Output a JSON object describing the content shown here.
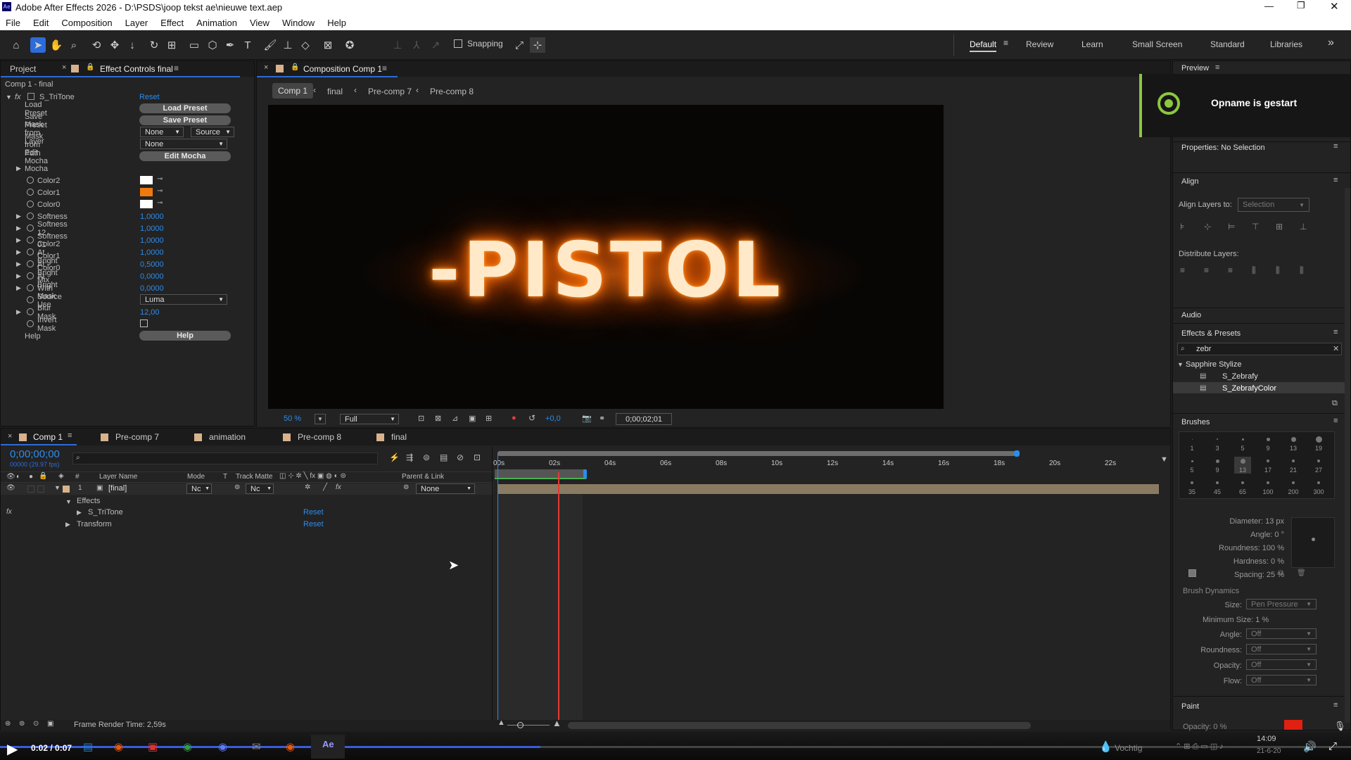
{
  "titlebar": {
    "title": "Adobe After Effects 2026 - D:\\PSDS\\joop tekst ae\\nieuwe text.aep",
    "app_icon": "Ae"
  },
  "menu": [
    "File",
    "Edit",
    "Composition",
    "Layer",
    "Effect",
    "Animation",
    "View",
    "Window",
    "Help"
  ],
  "toolbar": {
    "snapping": "Snapping",
    "workspaces": [
      "Default",
      "Review",
      "Learn",
      "Small Screen",
      "Standard",
      "Libraries"
    ],
    "overflow": "»"
  },
  "left_panel": {
    "tabs": {
      "project": "Project",
      "effect_controls": "Effect Controls final"
    },
    "header": "Comp 1 - final",
    "effect": {
      "name": "S_TriTone",
      "reset": "Reset"
    },
    "rows": {
      "load_preset": "Load Preset",
      "save_preset": "Save Preset",
      "mask_from_layer": "Mask from Layer",
      "mask_from_path": "Mask from Path",
      "edit_mocha": "Edit Mocha",
      "mocha": "Mocha",
      "color2": "Color2",
      "color1": "Color1",
      "color0": "Color0",
      "softness": "Softness",
      "softness_val": "1,0000",
      "softness12": "Softness 12",
      "softness12_val": "1,0000",
      "softness01": "Softness 01",
      "softness01_val": "1,0000",
      "color2_bright": "Color2 At Bright",
      "color2_bright_val": "1,0000",
      "color1_bright": "Color1 At Bright",
      "color1_bright_val": "0,5000",
      "color0_bright": "Color0 At Bright",
      "color0_bright_val": "0,0000",
      "mix": "Mix With Source",
      "mix_val": "0,0000",
      "mask_use": "Mask Use",
      "blur_mask": "Blur Mask",
      "blur_mask_val": "12,00",
      "invert_mask": "Invert Mask",
      "help": "Help"
    },
    "buttons": {
      "load_preset": "Load Preset",
      "save_preset": "Save Preset",
      "edit_mocha": "Edit Mocha",
      "help": "Help"
    },
    "dropdowns": {
      "mask_layer": "None",
      "mask_source": "Source",
      "mask_path": "None",
      "mask_use": "Luma"
    },
    "colors": {
      "color2": "#ffffff",
      "color1": "#f07a10",
      "color0": "#ffffff"
    }
  },
  "composition": {
    "tab": "Composition Comp 1",
    "breadcrumb": [
      "Comp 1",
      "final",
      "Pre-comp 7",
      "Pre-comp 8"
    ],
    "text": "-PISTOL",
    "zoom": "50 %",
    "resolution": "Full",
    "exposure": "+0,0",
    "timecode": "0;00;02;01"
  },
  "timeline": {
    "tabs": [
      "Comp 1",
      "Pre-comp 7",
      "animation",
      "Pre-comp 8",
      "final"
    ],
    "timecode": "0;00;00;00",
    "fps": "00000 (29.97 fps)",
    "columns": {
      "layer_name": "Layer Name",
      "mode": "Mode",
      "t": "T",
      "track_matte": "Track Matte",
      "parent": "Parent & Link",
      "hash": "#"
    },
    "layer": {
      "num": "1",
      "name": "[final]",
      "mode": "Nc",
      "matte": "Nc",
      "parent": "None"
    },
    "effects": "Effects",
    "effect_name": "S_TriTone",
    "transform": "Transform",
    "reset": "Reset",
    "ruler": [
      "00s",
      "02s",
      "04s",
      "06s",
      "08s",
      "10s",
      "12s",
      "14s",
      "16s",
      "18s",
      "20s",
      "22s"
    ],
    "frame_render": "Frame Render Time:  2,59s"
  },
  "right_panel": {
    "preview": "Preview",
    "toast": "Opname is gestart",
    "properties": "Properties: No Selection",
    "align": "Align",
    "align_layers_to": "Align Layers to:",
    "align_target": "Selection",
    "distribute": "Distribute Layers:",
    "audio": "Audio",
    "effects_presets": "Effects & Presets",
    "search": "zebr",
    "category": "Sapphire Stylize",
    "items": [
      "S_Zebrafy",
      "S_ZebrafyColor"
    ],
    "brushes": "Brushes",
    "brush_sizes": [
      "1",
      "3",
      "5",
      "9",
      "13",
      "19",
      "5",
      "9",
      "13",
      "17",
      "21",
      "27",
      "35",
      "45",
      "65",
      "100",
      "200",
      "300"
    ],
    "diameter": "Diameter: 13 px",
    "angle": "Angle: 0 °",
    "roundness": "Roundness: 100 %",
    "hardness": "Hardness: 0 %",
    "spacing": "Spacing: 25 %",
    "dynamics": "Brush Dynamics",
    "dyn_labels": {
      "size": "Size:",
      "min_size": "Minimum Size: 1 %",
      "angle": "Angle:",
      "roundness": "Roundness:",
      "opacity": "Opacity:",
      "flow": "Flow:"
    },
    "dyn_values": {
      "size": "Pen Pressure",
      "angle": "Off",
      "roundness": "Off",
      "opacity": "Off",
      "flow": "Off"
    },
    "paint": "Paint",
    "paint_opacity": "Opacity: 0 %"
  },
  "player": {
    "time": "0:02 / 0:07",
    "progress": 0.4,
    "weather": "Vochtig",
    "clock": "14:09",
    "date": "21-6-20"
  }
}
